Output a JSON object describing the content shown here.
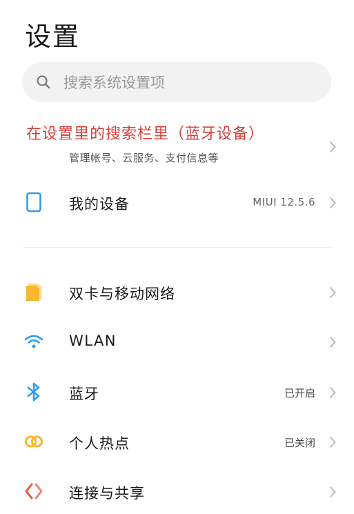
{
  "header": {
    "title": "设置"
  },
  "search": {
    "placeholder": "搜索系统设置项"
  },
  "annotation": {
    "text": "在设置里的搜索栏里（蓝牙设备）"
  },
  "account": {
    "subtitle": "管理帐号、云服务、支付信息等"
  },
  "device": {
    "label": "我的设备",
    "value": "MIUI  12.5.6"
  },
  "items": [
    {
      "label": "双卡与移动网络",
      "value": "",
      "icon": "sim-card-icon",
      "color": "#f5b82e"
    },
    {
      "label": "WLAN",
      "value": "",
      "icon": "wifi-icon",
      "color": "#2d9cf0"
    },
    {
      "label": "蓝牙",
      "value": "已开启",
      "icon": "bluetooth-icon",
      "color": "#2d9cf0"
    },
    {
      "label": "个人热点",
      "value": "已关闭",
      "icon": "hotspot-icon",
      "color": "#f5b82e"
    },
    {
      "label": "连接与共享",
      "value": "",
      "icon": "connection-share-icon",
      "color": "#e8553e"
    }
  ],
  "colors": {
    "accent_blue": "#2d9cf0",
    "accent_yellow": "#f5b82e",
    "annotation_red": "#d9403a"
  }
}
